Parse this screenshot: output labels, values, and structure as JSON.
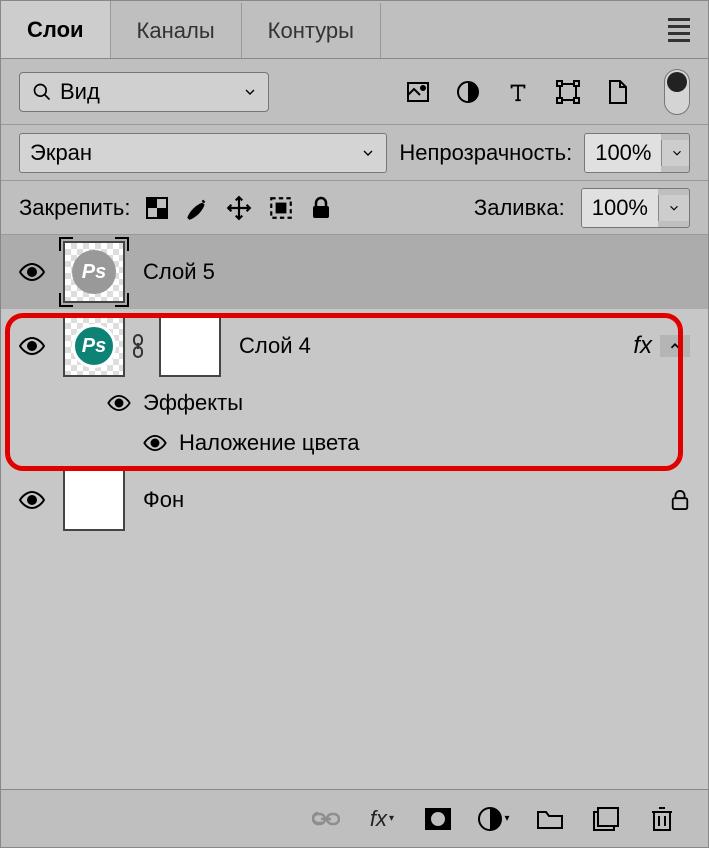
{
  "tabs": {
    "layers": "Слои",
    "channels": "Каналы",
    "paths": "Контуры"
  },
  "filter": {
    "label": "Вид"
  },
  "blend": {
    "mode": "Экран",
    "opacity_label": "Непрозрачность:",
    "opacity_value": "100%"
  },
  "lock": {
    "label": "Закрепить:",
    "fill_label": "Заливка:",
    "fill_value": "100%"
  },
  "layers": {
    "layer5": {
      "name": "Слой 5"
    },
    "layer4": {
      "name": "Слой 4",
      "fx": "fx",
      "effects_label": "Эффекты",
      "color_overlay": "Наложение цвета"
    },
    "background": {
      "name": "Фон"
    }
  }
}
